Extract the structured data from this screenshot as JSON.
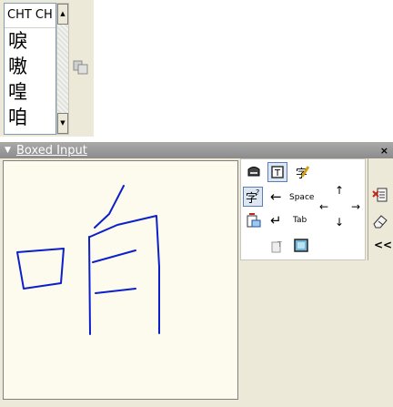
{
  "candidate_window": {
    "header": "CHT CH",
    "items": [
      "唳",
      "嗷",
      "喤",
      "咱"
    ]
  },
  "panel": {
    "title": "Boxed Input",
    "close_glyph": "×",
    "keys": {
      "space_label": "Space",
      "tab_label": "Tab",
      "back_glyph": "←",
      "enter_glyph": "↵",
      "collapse_glyph": "<<"
    },
    "icons": {
      "keyboard": "keyboard-icon",
      "text_mode": "text-mode-icon",
      "edit": "edit-icon",
      "correction": "correction-icon",
      "paste": "paste-icon",
      "convert": "convert-icon",
      "screen": "screen-icon",
      "clear": "clear-list-icon",
      "eraser": "eraser-icon"
    }
  },
  "colors": {
    "ink": "#0b1fcc",
    "writing_bg": "#fdfaee",
    "title_bar": "#9a9a9a",
    "frame": "#ece9d8",
    "accent_red": "#c0281c"
  }
}
